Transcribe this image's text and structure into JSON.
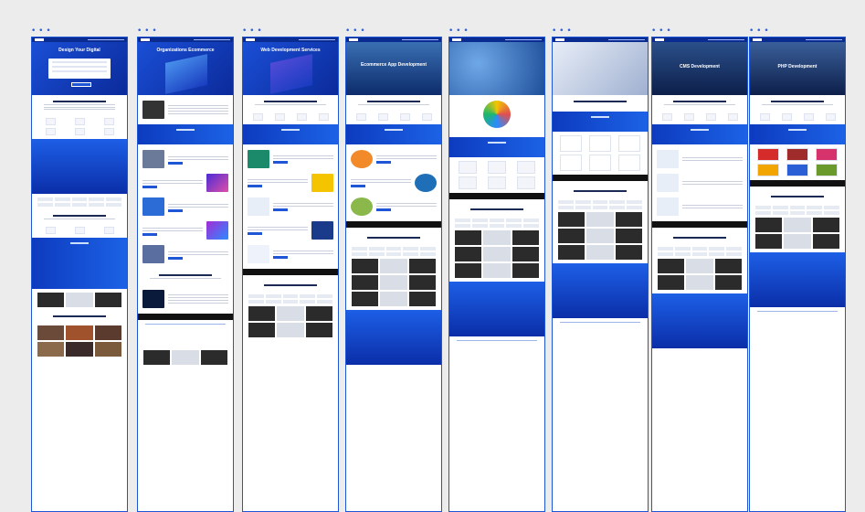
{
  "frames": [
    {
      "id": "f1",
      "dots": "• • •",
      "title": "Design Your Digital"
    },
    {
      "id": "f2",
      "dots": "• • •",
      "title": "Organizations Ecommerce"
    },
    {
      "id": "f3",
      "dots": "• • •",
      "title": "Web Development Services"
    },
    {
      "id": "f4",
      "dots": "• • •",
      "title": "Ecommerce App Development"
    },
    {
      "id": "f5",
      "dots": "• • •",
      "title": ""
    },
    {
      "id": "f6",
      "dots": "• • •",
      "title": ""
    },
    {
      "id": "f7",
      "dots": "• • •",
      "title": "CMS Development"
    },
    {
      "id": "f8",
      "dots": "• • •",
      "title": "PHP Development"
    }
  ],
  "frame_left_positions_note": "layout only",
  "colors": {
    "brand": "#1f56d6",
    "dark_nav": "#0a2b8f"
  }
}
